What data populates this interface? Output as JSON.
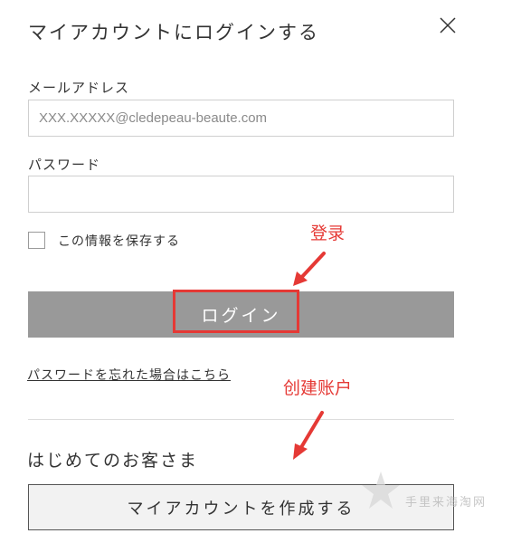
{
  "dialog": {
    "title": "マイアカウントにログインする",
    "close_icon": "close-icon"
  },
  "login_form": {
    "email_label": "メールアドレス",
    "email_placeholder": "XXX.XXXXX@cledepeau-beaute.com",
    "email_value": "",
    "password_label": "パスワード",
    "password_value": "",
    "remember_label": "この情報を保存する",
    "remember_checked": false,
    "login_button": "ログイン",
    "forgot_link": "パスワードを忘れた場合はこちら"
  },
  "register": {
    "heading": "はじめてのお客さま",
    "create_button": "マイアカウントを作成する"
  },
  "annotations": {
    "login_note": "登录",
    "create_note": "创建账户",
    "color": "#e53935"
  },
  "watermark": {
    "text": "手里来海淘网"
  }
}
